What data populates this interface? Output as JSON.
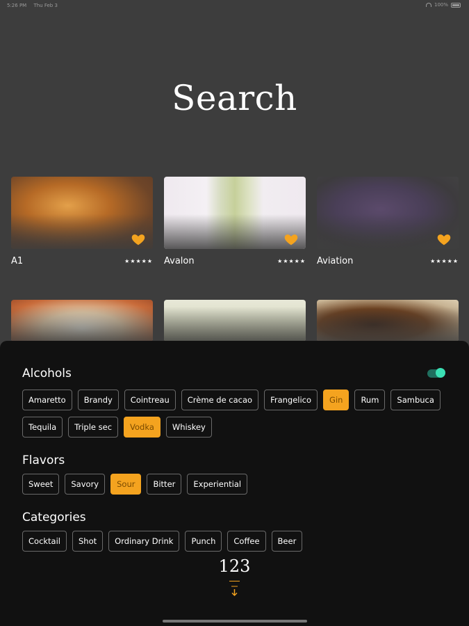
{
  "status": {
    "time": "5:26 PM",
    "date": "Thu Feb 3",
    "battery": "100%"
  },
  "title": "Search",
  "drinks": [
    {
      "name": "A1",
      "stars": "★★★★★",
      "favorite": true
    },
    {
      "name": "Avalon",
      "stars": "★★★★★",
      "favorite": true
    },
    {
      "name": "Aviation",
      "stars": "★★★★★",
      "favorite": true
    }
  ],
  "filters": {
    "alcohols": {
      "heading": "Alcohols",
      "toggle_on": true,
      "row1": [
        "Amaretto",
        "Brandy",
        "Cointreau",
        "Crème de cacao",
        "Frangelico",
        "Gin",
        "Rum",
        "Sambuca"
      ],
      "row2": [
        "Tequila",
        "Triple sec",
        "Vodka",
        "Whiskey"
      ],
      "selected": [
        "Gin",
        "Vodka"
      ]
    },
    "flavors": {
      "heading": "Flavors",
      "items": [
        "Sweet",
        "Savory",
        "Sour",
        "Bitter",
        "Experiential"
      ],
      "selected": [
        "Sour"
      ]
    },
    "categories": {
      "heading": "Categories",
      "items": [
        "Cocktail",
        "Shot",
        "Ordinary Drink",
        "Punch",
        "Coffee",
        "Beer"
      ],
      "selected": []
    }
  },
  "result_count": "123",
  "colors": {
    "accent": "#f4a31f",
    "toggle": "#3be0b4",
    "sheet": "#111111",
    "background": "#3d3d3d"
  }
}
